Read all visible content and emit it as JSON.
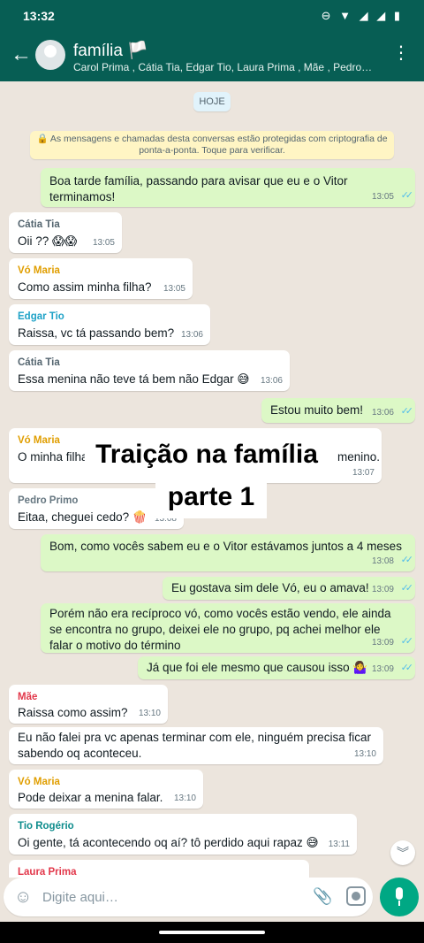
{
  "status_bar": {
    "time": "13:32"
  },
  "header": {
    "title": "família 🏳️",
    "subtitle": "Carol Prima , Cátia Tia, Edgar Tio, Laura Prima , Mãe , Pedro…"
  },
  "chat": {
    "date_chip": "HOJE",
    "encryption_notice": "🔒 As mensagens e chamadas desta conversas estão protegidas com criptografia de ponta-a-ponta. Toque para verificar.",
    "messages": [
      {
        "direction": "out",
        "text": "Boa tarde família, passando para avisar que eu e o Vitor terminamos!",
        "time": "13:05"
      },
      {
        "direction": "in",
        "sender": "Cátia Tia",
        "text": "Oii ?? 😱😱",
        "time": "13:05"
      },
      {
        "direction": "in",
        "sender": "Vó Maria",
        "text": "Como assim minha filha?",
        "time": "13:05"
      },
      {
        "direction": "in",
        "sender": "Edgar Tio",
        "text": "Raissa, vc tá passando bem?",
        "time": "13:06"
      },
      {
        "direction": "in",
        "sender": "Cátia Tia",
        "text": "Essa menina não teve tá bem não Edgar 😅",
        "time": "13:06"
      },
      {
        "direction": "out",
        "text": "Estou muito bem!",
        "time": "13:06"
      },
      {
        "direction": "in",
        "sender": "Vó Maria",
        "text_start": "O minha filha",
        "text_end": "menino.",
        "time": "13:07"
      },
      {
        "direction": "in",
        "sender": "Pedro Primo",
        "text": "Eitaa, cheguei cedo? 🍿",
        "time": "13:08"
      },
      {
        "direction": "out",
        "text": "Bom, como vocês sabem eu e o Vitor estávamos juntos a 4 meses",
        "time": "13:08"
      },
      {
        "direction": "out",
        "text": "Eu gostava sim dele Vó, eu o amava!",
        "time": "13:09"
      },
      {
        "direction": "out",
        "text": "Porém não era recíproco vó, como vocês estão vendo, ele ainda se encontra no grupo, deixei ele no grupo, pq achei melhor ele falar o motivo do término",
        "time": "13:09"
      },
      {
        "direction": "out",
        "text": "Já que foi ele mesmo que causou isso 🤷‍♀️",
        "time": "13:09"
      },
      {
        "direction": "in",
        "sender": "Mãe",
        "text": "Raissa como assim?",
        "time": "13:10"
      },
      {
        "direction": "in",
        "text": "Eu não falei pra vc apenas terminar com ele, ninguém precisa ficar sabendo oq aconteceu.",
        "time": "13:10"
      },
      {
        "direction": "in",
        "sender": "Vó Maria",
        "text": "Pode deixar a menina falar.",
        "time": "13:10"
      },
      {
        "direction": "in",
        "sender": "Tio Rogério",
        "text": "Oi gente, tá acontecendo oq aí? tô perdido aqui rapaz 😅",
        "time": "13:11"
      },
      {
        "direction": "in",
        "sender": "Laura Prima"
      }
    ],
    "overlay": {
      "line1": "Traição na família",
      "line2": "parte 1"
    }
  },
  "composer": {
    "placeholder": "Digite aqui…"
  },
  "colors": {
    "header": "#075e54",
    "outgoing_bubble": "#dcf8c6",
    "incoming_bubble": "#ffffff",
    "chat_background": "#ece5dd",
    "mic_button": "#00a884",
    "read_ticks": "#53bdeb",
    "sender_colors": {
      "Cátia Tia": "#54656f",
      "Vó Maria": "#e09e00",
      "Edgar Tio": "#1fa2c7",
      "Pedro Primo": "#667781",
      "Mãe": "#e2374a",
      "Tio Rogério": "#0d8c8c",
      "Laura Prima": "#e2374a"
    }
  },
  "icons": {
    "back": "arrow-left-icon",
    "menu": "more-vert-icon",
    "emoji": "smiley-icon",
    "attach": "paperclip-icon",
    "camera": "camera-icon",
    "mic": "mic-icon",
    "scroll": "chevron-down-double-icon",
    "ticks": "double-check-icon"
  }
}
